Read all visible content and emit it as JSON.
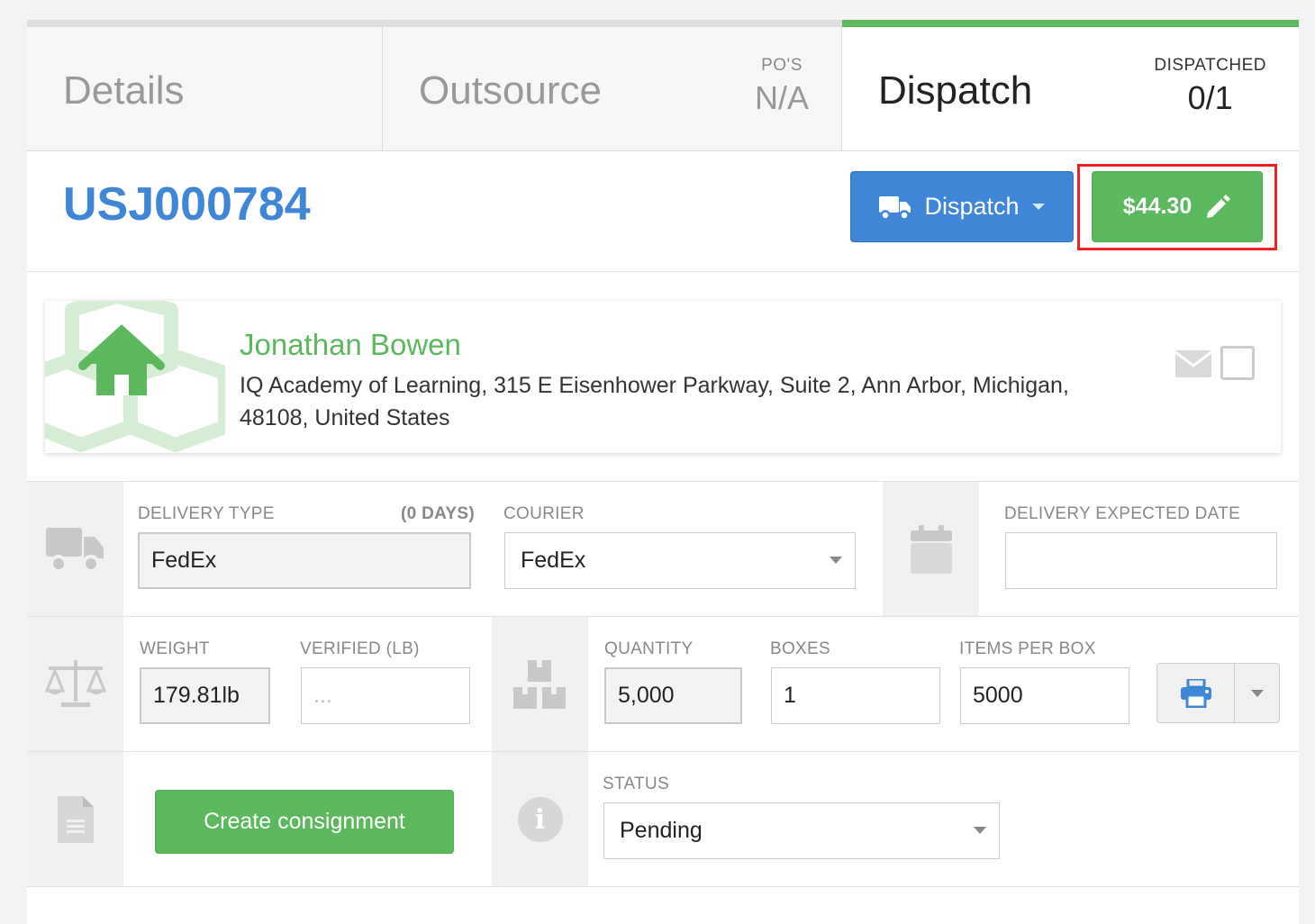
{
  "tabs": {
    "details": {
      "label": "Details"
    },
    "outsource": {
      "label": "Outsource",
      "stat_label": "PO'S",
      "stat_value": "N/A"
    },
    "dispatch": {
      "label": "Dispatch",
      "stat_label": "DISPATCHED",
      "stat_value": "0/1"
    }
  },
  "header": {
    "job_id": "USJ000784",
    "dispatch_button": "Dispatch",
    "price_button": "$44.30"
  },
  "address": {
    "name": "Jonathan Bowen",
    "text": "IQ Academy of Learning, 315 E Eisenhower Parkway, Suite 2, Ann Arbor, Michigan, 48108, United States"
  },
  "delivery": {
    "type_label": "DELIVERY TYPE",
    "type_days": "(0 DAYS)",
    "type_value": "FedEx",
    "courier_label": "COURIER",
    "courier_value": "FedEx",
    "expected_label": "DELIVERY EXPECTED DATE",
    "expected_value": ""
  },
  "weights": {
    "weight_label": "WEIGHT",
    "weight_value": "179.81lb",
    "verified_label": "VERIFIED (LB)",
    "verified_placeholder": "...",
    "quantity_label": "QUANTITY",
    "quantity_value": "5,000",
    "boxes_label": "BOXES",
    "boxes_value": "1",
    "items_label": "ITEMS PER BOX",
    "items_value": "5000"
  },
  "actions": {
    "consign_button": "Create consignment",
    "status_label": "STATUS",
    "status_value": "Pending"
  },
  "colors": {
    "accent_blue": "#3f86d6",
    "accent_green": "#5cb85c",
    "highlight_red": "#e22222"
  }
}
